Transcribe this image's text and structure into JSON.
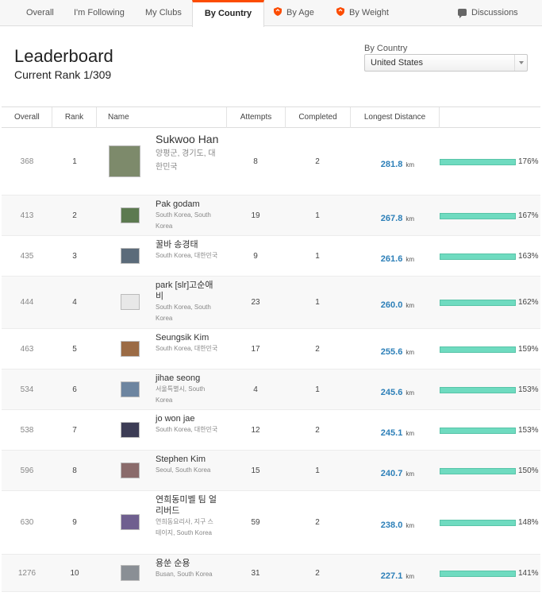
{
  "tabs": [
    {
      "label": "Overall",
      "icon": ""
    },
    {
      "label": "I'm Following",
      "icon": ""
    },
    {
      "label": "My Clubs",
      "icon": ""
    },
    {
      "label": "By Country",
      "icon": "",
      "active": true
    },
    {
      "label": "By Age",
      "icon": "shield-icon"
    },
    {
      "label": "By Weight",
      "icon": "shield-icon"
    },
    {
      "label": "Discussions",
      "icon": "chat-icon"
    }
  ],
  "header": {
    "title": "Leaderboard",
    "rank": "Current Rank 1/309",
    "filter_label": "By Country",
    "filter_value": "United States"
  },
  "columns": {
    "overall": "Overall",
    "rank": "Rank",
    "name": "Name",
    "attempts": "Attempts",
    "completed": "Completed",
    "longest": "Longest Distance"
  },
  "colors": {
    "accent": "#fc4c02",
    "bar": "#6fdbc0",
    "distance": "#2c7fb8"
  },
  "rows": [
    {
      "overall": "368",
      "rank": "1",
      "name": "Sukwoo Han",
      "location": "양평군, 경기도, 대한민국",
      "attempts": "8",
      "completed": "2",
      "distance": "281.8",
      "unit": "km",
      "percent": "176%"
    },
    {
      "overall": "413",
      "rank": "2",
      "name": "Pak godam",
      "location": "South Korea, South Korea",
      "attempts": "19",
      "completed": "1",
      "distance": "267.8",
      "unit": "km",
      "percent": "167%"
    },
    {
      "overall": "435",
      "rank": "3",
      "name": "꿀바 송경태",
      "location": "South Korea, 대한민국",
      "attempts": "9",
      "completed": "1",
      "distance": "261.6",
      "unit": "km",
      "percent": "163%"
    },
    {
      "overall": "444",
      "rank": "4",
      "name": "park [slr]고순애비",
      "location": "South Korea, South Korea",
      "attempts": "23",
      "completed": "1",
      "distance": "260.0",
      "unit": "km",
      "percent": "162%"
    },
    {
      "overall": "463",
      "rank": "5",
      "name": "Seungsik Kim",
      "location": "South Korea, 대한민국",
      "attempts": "17",
      "completed": "2",
      "distance": "255.6",
      "unit": "km",
      "percent": "159%"
    },
    {
      "overall": "534",
      "rank": "6",
      "name": "jihae seong",
      "location": "서울특별시, South Korea",
      "attempts": "4",
      "completed": "1",
      "distance": "245.6",
      "unit": "km",
      "percent": "153%"
    },
    {
      "overall": "538",
      "rank": "7",
      "name": "jo won jae",
      "location": "South Korea, 대한민국",
      "attempts": "12",
      "completed": "2",
      "distance": "245.1",
      "unit": "km",
      "percent": "153%"
    },
    {
      "overall": "596",
      "rank": "8",
      "name": "Stephen Kim",
      "location": "Seoul, South Korea",
      "attempts": "15",
      "completed": "1",
      "distance": "240.7",
      "unit": "km",
      "percent": "150%"
    },
    {
      "overall": "630",
      "rank": "9",
      "name": "연희동미벨 팀 얼리버드",
      "location": "연희동요리사, 지구 스테이지, South Korea",
      "attempts": "59",
      "completed": "2",
      "distance": "238.0",
      "unit": "km",
      "percent": "148%"
    },
    {
      "overall": "1276",
      "rank": "10",
      "name": "용쑨 순용",
      "location": "Busan, South Korea",
      "attempts": "31",
      "completed": "2",
      "distance": "227.1",
      "unit": "km",
      "percent": "141%"
    }
  ]
}
